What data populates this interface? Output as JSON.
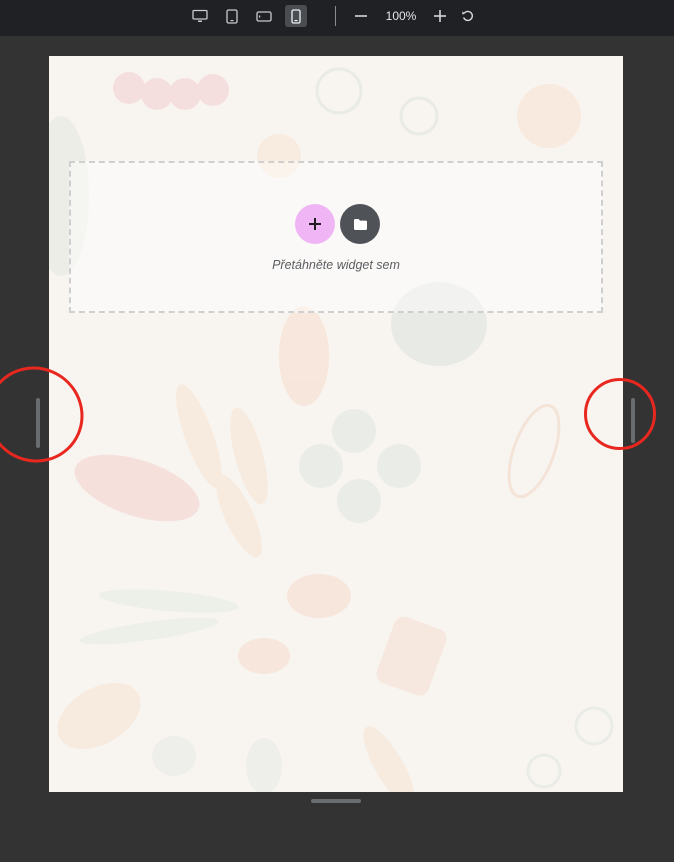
{
  "toolbar": {
    "devices": [
      {
        "name": "desktop",
        "icon": "desktop-icon",
        "active": false
      },
      {
        "name": "tablet",
        "icon": "tablet-icon",
        "active": false
      },
      {
        "name": "mobile-landscape",
        "icon": "mobile-landscape-icon",
        "active": false
      },
      {
        "name": "mobile",
        "icon": "mobile-icon",
        "active": true
      }
    ],
    "zoom_label": "100%",
    "zoom_out_icon": "minus-icon",
    "zoom_in_icon": "plus-icon",
    "reset_icon": "reset-icon"
  },
  "dropzone": {
    "hint": "Přetáhněte widget sem",
    "add_icon": "plus-icon",
    "template_icon": "folder-icon"
  },
  "colors": {
    "add_button": "#f0b5f4",
    "folder_button": "#4f5358",
    "canvas": "#f8f4f0",
    "annotation": "#e8271f"
  }
}
